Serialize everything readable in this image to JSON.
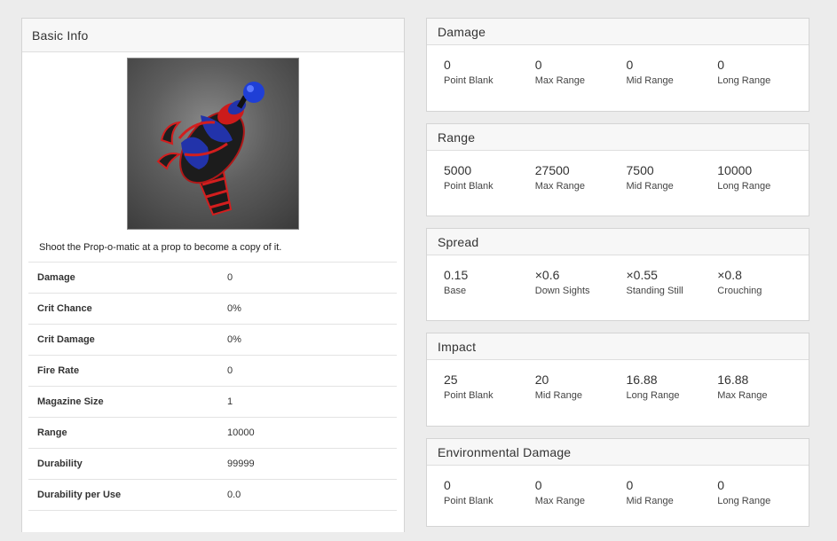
{
  "basic_info": {
    "title": "Basic Info",
    "description": "Shoot the Prop-o-matic at a prop to become a copy of it.",
    "stats": [
      {
        "label": "Damage",
        "value": "0"
      },
      {
        "label": "Crit Chance",
        "value": "0%"
      },
      {
        "label": "Crit Damage",
        "value": "0%"
      },
      {
        "label": "Fire Rate",
        "value": "0"
      },
      {
        "label": "Magazine Size",
        "value": "1"
      },
      {
        "label": "Range",
        "value": "10000"
      },
      {
        "label": "Durability",
        "value": "99999"
      },
      {
        "label": "Durability per Use",
        "value": "0.0"
      }
    ]
  },
  "cards": [
    {
      "title": "Damage",
      "cells": [
        {
          "value": "0",
          "label": "Point Blank"
        },
        {
          "value": "0",
          "label": "Max Range"
        },
        {
          "value": "0",
          "label": "Mid Range"
        },
        {
          "value": "0",
          "label": "Long Range"
        }
      ]
    },
    {
      "title": "Range",
      "cells": [
        {
          "value": "5000",
          "label": "Point Blank"
        },
        {
          "value": "27500",
          "label": "Max Range"
        },
        {
          "value": "7500",
          "label": "Mid Range"
        },
        {
          "value": "10000",
          "label": "Long Range"
        }
      ]
    },
    {
      "title": "Spread",
      "cells": [
        {
          "value": "0.15",
          "label": "Base"
        },
        {
          "value": "×0.6",
          "label": "Down Sights"
        },
        {
          "value": "×0.55",
          "label": "Standing Still"
        },
        {
          "value": "×0.8",
          "label": "Crouching"
        }
      ]
    },
    {
      "title": "Impact",
      "cells": [
        {
          "value": "25",
          "label": "Point Blank"
        },
        {
          "value": "20",
          "label": "Mid Range"
        },
        {
          "value": "16.88",
          "label": "Long Range"
        },
        {
          "value": "16.88",
          "label": "Max Range"
        }
      ]
    },
    {
      "title": "Environmental Damage",
      "cells": [
        {
          "value": "0",
          "label": "Point Blank"
        },
        {
          "value": "0",
          "label": "Max Range"
        },
        {
          "value": "0",
          "label": "Mid Range"
        },
        {
          "value": "0",
          "label": "Long Range"
        }
      ]
    }
  ]
}
